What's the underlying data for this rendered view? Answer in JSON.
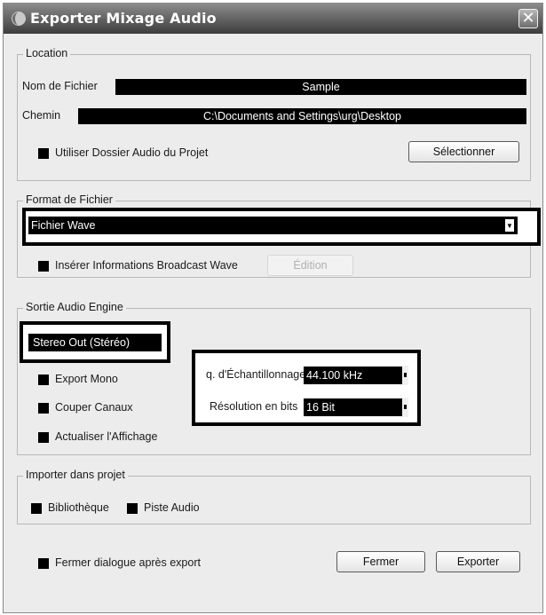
{
  "window": {
    "title": "Exporter Mixage Audio",
    "close_glyph": "✕"
  },
  "location": {
    "legend": "Location",
    "filename_label": "Nom de Fichier",
    "filename_value": "Sample",
    "path_label": "Chemin",
    "path_value": "C:\\Documents and Settings\\urg\\Desktop",
    "use_project_folder_label": "Utiliser Dossier Audio du Projet",
    "select_button": "Sélectionner"
  },
  "format": {
    "legend": "Format de Fichier",
    "selected": "Fichier Wave",
    "broadcast_label": "Insérer Informations Broadcast Wave",
    "edit_button": "Édition"
  },
  "engine": {
    "legend": "Sortie Audio Engine",
    "output_value": "Stereo Out (Stéréo)",
    "export_mono": "Export Mono",
    "split_channels": "Couper Canaux",
    "update_display": "Actualiser l'Affichage",
    "sample_rate_label": "q. d'Échantillonnage",
    "sample_rate_value": "44.100 kHz",
    "bit_depth_label": "Résolution en bits",
    "bit_depth_value": "16 Bit"
  },
  "import": {
    "legend": "Importer dans projet",
    "library": "Bibliothèque",
    "audio_track": "Piste Audio"
  },
  "footer": {
    "close_after_export": "Fermer dialogue après export",
    "close_button": "Fermer",
    "export_button": "Exporter"
  },
  "icons": {
    "app_icon": "app-icon",
    "close_icon": "close-icon",
    "dropdown_arrow": "chevron-down-icon"
  }
}
